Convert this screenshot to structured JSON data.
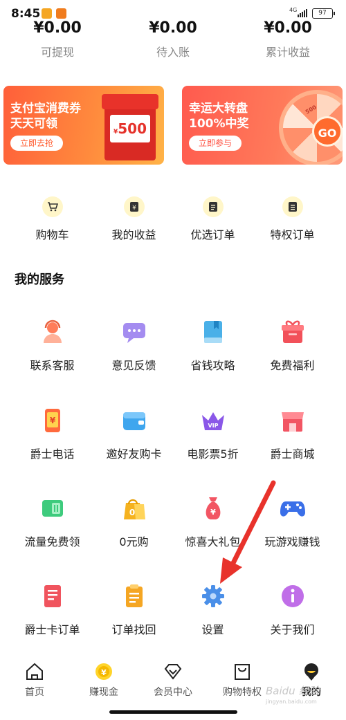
{
  "status_bar": {
    "time": "8:45",
    "network": "4G",
    "battery": "97"
  },
  "earnings": [
    {
      "value": "¥0.00",
      "label": "可提现"
    },
    {
      "value": "¥0.00",
      "label": "待入账"
    },
    {
      "value": "¥0.00",
      "label": "累计收益"
    }
  ],
  "banners": [
    {
      "title_line1": "支付宝消费券",
      "title_line2": "天天可领",
      "button": "立即去抢",
      "card_value": "500",
      "card_currency": "¥"
    },
    {
      "title_line1": "幸运大转盘",
      "title_line2": "100%中奖",
      "button": "立即参与",
      "wheel_button": "GO",
      "wheel_label": "500"
    }
  ],
  "quick_links": [
    {
      "label": "购物车",
      "icon": "cart-icon"
    },
    {
      "label": "我的收益",
      "icon": "earnings-icon"
    },
    {
      "label": "优选订单",
      "icon": "order-icon"
    },
    {
      "label": "特权订单",
      "icon": "privilege-order-icon"
    }
  ],
  "services_title": "我的服务",
  "services": [
    {
      "label": "联系客服",
      "icon": "customer-service-icon"
    },
    {
      "label": "意见反馈",
      "icon": "feedback-icon"
    },
    {
      "label": "省钱攻略",
      "icon": "guide-book-icon"
    },
    {
      "label": "免费福利",
      "icon": "gift-icon"
    },
    {
      "label": "爵士电话",
      "icon": "phone-icon"
    },
    {
      "label": "邀好友购卡",
      "icon": "wallet-card-icon"
    },
    {
      "label": "电影票5折",
      "icon": "vip-crown-icon"
    },
    {
      "label": "爵士商城",
      "icon": "store-icon"
    },
    {
      "label": "流量免费领",
      "icon": "sim-card-icon"
    },
    {
      "label": "0元购",
      "icon": "shopping-bag-icon"
    },
    {
      "label": "惊喜大礼包",
      "icon": "money-bag-icon"
    },
    {
      "label": "玩游戏赚钱",
      "icon": "gamepad-icon"
    },
    {
      "label": "爵士卡订单",
      "icon": "card-order-icon"
    },
    {
      "label": "订单找回",
      "icon": "clipboard-icon"
    },
    {
      "label": "设置",
      "icon": "settings-gear-icon"
    },
    {
      "label": "关于我们",
      "icon": "info-icon"
    }
  ],
  "nav": [
    {
      "label": "首页",
      "icon": "home-icon"
    },
    {
      "label": "赚现金",
      "icon": "coin-icon"
    },
    {
      "label": "会员中心",
      "icon": "diamond-icon"
    },
    {
      "label": "购物特权",
      "icon": "bag-icon"
    },
    {
      "label": "我的",
      "icon": "profile-icon",
      "active": true
    }
  ],
  "watermark": {
    "text": "Baidu 经验",
    "url": "jingyan.baidu.com"
  },
  "colors": {
    "accent": "#ff4a3a",
    "arrow": "#e8322b"
  }
}
